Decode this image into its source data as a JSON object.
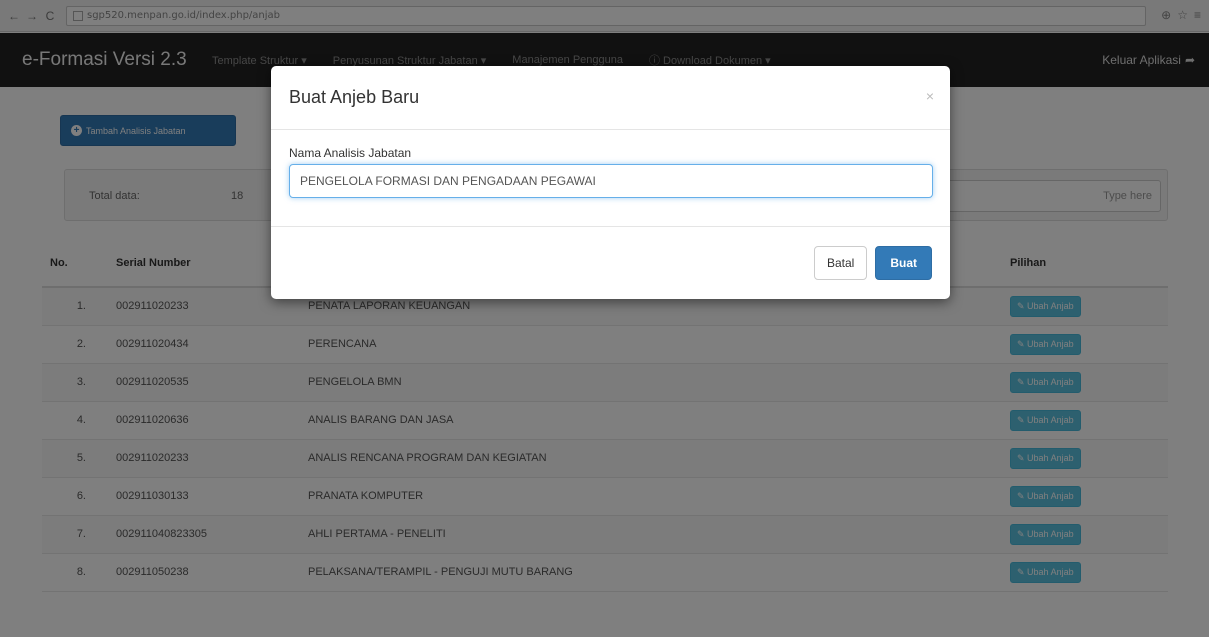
{
  "browser": {
    "url": "sgp520.menpan.go.id/index.php/anjab",
    "back_icon": "arrow-left-icon",
    "forward_icon": "arrow-right-icon",
    "reload_icon": "reload-icon"
  },
  "navbar": {
    "brand": "e-Formasi Versi 2.3",
    "items": [
      "Template Struktur ▾",
      "Penyusunan Struktur Jabatan ▾",
      "Manajemen Pengguna",
      "ⓘ Download Dokumen ▾"
    ],
    "exit_label": "Keluar Aplikasi"
  },
  "page": {
    "add_button_label": "Tambah Analisis Jabatan",
    "total_label": "Total data:",
    "total_value": "18",
    "search_placeholder": "Type here"
  },
  "table": {
    "headers": {
      "no": "No.",
      "serial": "Serial Number",
      "name": "",
      "pilihan": "Pilihan"
    },
    "action_label": "Ubah Anjab",
    "rows": [
      {
        "no": "1.",
        "serial": "002911020233",
        "name": "PENATA LAPORAN KEUANGAN"
      },
      {
        "no": "2.",
        "serial": "002911020434",
        "name": "PERENCANA"
      },
      {
        "no": "3.",
        "serial": "002911020535",
        "name": "PENGELOLA BMN"
      },
      {
        "no": "4.",
        "serial": "002911020636",
        "name": "ANALIS BARANG DAN JASA"
      },
      {
        "no": "5.",
        "serial": "002911020233",
        "name": "ANALIS RENCANA PROGRAM DAN KEGIATAN"
      },
      {
        "no": "6.",
        "serial": "002911030133",
        "name": "PRANATA KOMPUTER"
      },
      {
        "no": "7.",
        "serial": "002911040823305",
        "name": "AHLI PERTAMA - PENELITI"
      },
      {
        "no": "8.",
        "serial": "002911050238",
        "name": "PELAKSANA/TERAMPIL - PENGUJI MUTU BARANG"
      }
    ]
  },
  "modal": {
    "title": "Buat Anjeb Baru",
    "field_label": "Nama Analisis Jabatan",
    "field_value": "PENGELOLA FORMASI DAN PENGADAAN PEGAWAI",
    "cancel_label": "Batal",
    "create_label": "Buat",
    "close_glyph": "×"
  }
}
